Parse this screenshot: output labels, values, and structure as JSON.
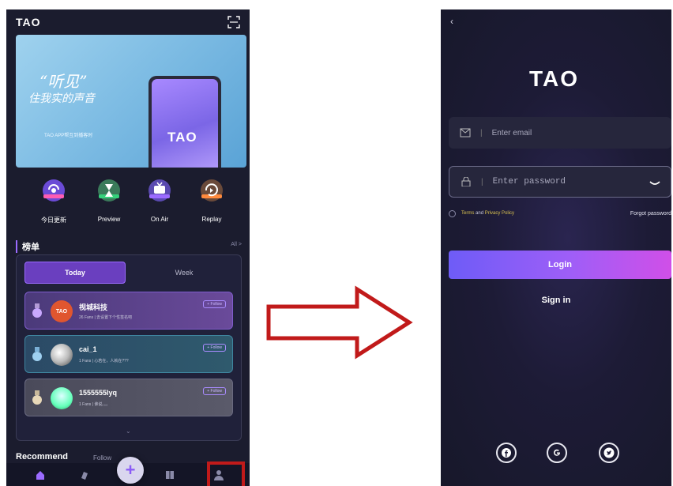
{
  "left_screen": {
    "logo": "TAO",
    "banner": {
      "calli_main": "“听见”",
      "calli_line": "住我实的声音",
      "subtitle": "TAO APP帮互到播客时",
      "phone_logo": "TAO"
    },
    "quick_actions": [
      {
        "label": "今日更新",
        "icon": "today-icon"
      },
      {
        "label": "Preview",
        "icon": "hourglass-icon"
      },
      {
        "label": "On Air",
        "icon": "live-tv-icon"
      },
      {
        "label": "Replay",
        "icon": "replay-icon"
      }
    ],
    "ranking": {
      "title": "榜单",
      "all_label": "All >",
      "tabs": {
        "today": "Today",
        "week": "Week"
      },
      "items": [
        {
          "name": "视城科技",
          "meta": "26 Fans  |  去设置下个性签名吧",
          "avatar_text": "TAO",
          "follow": "+ Follow"
        },
        {
          "name": "cai_1",
          "meta": "1 Fans  |  心若在，人就在???",
          "avatar_text": "",
          "follow": "+ Follow"
        },
        {
          "name": "1555555lyq",
          "meta": "1 Fans  |  谁说。。。",
          "avatar_text": "",
          "follow": "+ Follow"
        }
      ],
      "more": "⌄"
    },
    "recommend": "Recommend",
    "follow_tab": "Follow",
    "fab": "+"
  },
  "right_screen": {
    "back": "‹",
    "logo": "TAO",
    "email_placeholder": "Enter email",
    "password_placeholder": "Enter password",
    "separator": "|",
    "terms_text": "Terms",
    "terms_and": "and",
    "privacy_text": "Privacy Policy",
    "forgot": "Forgot password",
    "login": "Login",
    "signin": "Sign in"
  },
  "colors": {
    "accent": "#9b6bff",
    "highlight_box": "#c11a1a",
    "arrow": "#c11a1a",
    "terms": "#d8c050"
  }
}
